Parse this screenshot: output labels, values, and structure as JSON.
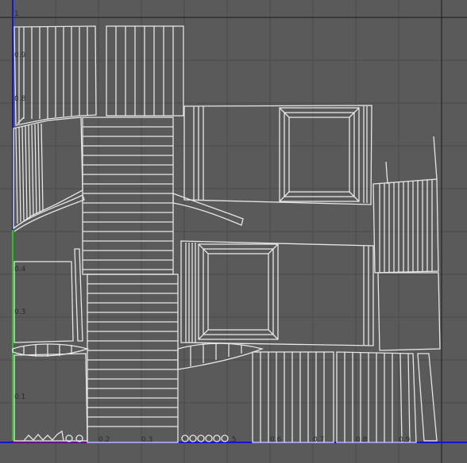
{
  "uv_editor": {
    "axis_labels": {
      "v_1": "1",
      "v_0_9": "0.9",
      "v_0_8": "0.8",
      "v_0_4": "0.4",
      "v_0_3": "0.3",
      "v_0_1": "0.1",
      "u_0_2": "0.2",
      "u_0_3": "0.3",
      "u_0_5": ".5",
      "u_0_6": "0.6",
      "u_0_7": "0.7",
      "u_0_8": "0.8",
      "u_0_9": "0.9"
    },
    "colors": {
      "background": "#5a5a5a",
      "grid": "#4c4c4c",
      "uv_border": "#1a1a1a",
      "wire": "#e6e6e6",
      "u_axis": "#1414d2",
      "v_axis": "#1ec81e",
      "red_axis": "#d21414"
    }
  }
}
